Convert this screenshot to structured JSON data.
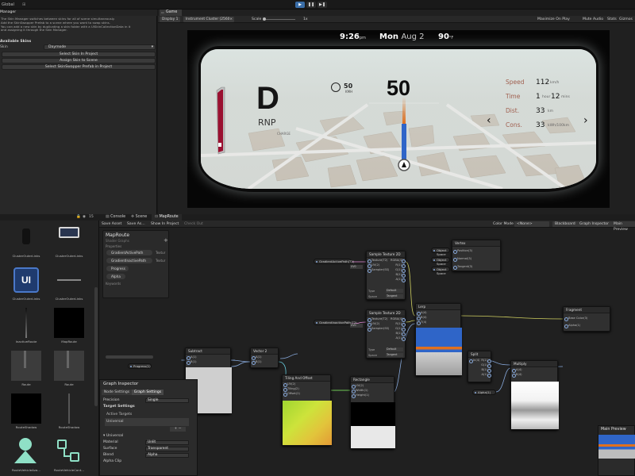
{
  "topbar": {
    "left_label": "Global",
    "play_buttons": [
      "▶",
      "❚❚",
      "▶❚"
    ]
  },
  "skin_manager": {
    "tab_label": "Manager",
    "description": [
      "The Skin Manager switches between skins for all of scene simultaneously.",
      "Add the SkinSwapper Prefab to a scene where you want to swap skins.",
      "You can add a new skin by duplicating a skin folder with a UISkinCollectionData in it",
      "and assigning it through the Skin Manager."
    ],
    "available_skins_label": "Available Skins",
    "skin_label": "Skin",
    "skin_value": "Daymode",
    "buttons": [
      "Select Skin In Project",
      "Assign Skin to Scene",
      "Select SkinSwapper Prefab in Project"
    ]
  },
  "game_view": {
    "tab_label": "Game",
    "display": "Display 1",
    "resolution": "Instrument Cluster (2560×",
    "scale_label": "Scale",
    "scale_value": "1x",
    "toolbar_right": [
      "Maximize On Play",
      "Mute Audio",
      "Stats",
      "Gizmos"
    ]
  },
  "cluster": {
    "time": "9:26",
    "time_suffix": "pm",
    "day": "Mon",
    "date": "Aug 2",
    "temp": "90",
    "temp_unit": "°F",
    "gear": "D",
    "gear_modes": "RNP",
    "charge_label": "CHARGE",
    "speed_limit": "50",
    "speed_limit_unit": "KMH",
    "speed": "50",
    "stats": [
      {
        "label": "Speed",
        "value": "112",
        "unit": "km/h"
      },
      {
        "label": "Time",
        "value": "1",
        "unit2": "hour",
        "value2": "12",
        "unit": "mins"
      },
      {
        "label": "Dist.",
        "value": "33",
        "unit": "km"
      },
      {
        "label": "Cons.",
        "value": "33",
        "unit": "kWh/100km"
      }
    ]
  },
  "project_panel": {
    "counter": "15",
    "items": [
      {
        "label": "ClusterOuterLinks",
        "kind": "dark-dot"
      },
      {
        "label": "ClusterOuterLinks",
        "kind": "box-icon"
      },
      {
        "label": "ClusterOuterLinks",
        "kind": "ui-icon"
      },
      {
        "label": "ClusterOuterLinks",
        "kind": "line"
      },
      {
        "label": "InactiveRoute",
        "kind": "gradient-line"
      },
      {
        "label": "MapRoute",
        "kind": "black"
      },
      {
        "label": "Route",
        "kind": "grey-route"
      },
      {
        "label": "Route",
        "kind": "grey-route"
      },
      {
        "label": "RouteShadow",
        "kind": "black"
      },
      {
        "label": "RouteShadow",
        "kind": "vline"
      },
      {
        "label": "RouteVehicleAva...",
        "kind": "avatar"
      },
      {
        "label": "RouteVehicleCont...",
        "kind": "control"
      }
    ]
  },
  "graph": {
    "tabs": [
      "Console",
      "Scene",
      "MapRoute"
    ],
    "toolbar_left": [
      "Save Asset",
      "Save As...",
      "Show In Project",
      "Check Out"
    ],
    "color_mode_label": "Color Mode",
    "color_mode_value": "<None>",
    "toolbar_right": [
      "Blackboard",
      "Graph Inspector",
      "Main Preview"
    ],
    "blackboard": {
      "title": "MapRoute",
      "subtitle": "Shader Graphs",
      "section": "Properties",
      "properties": [
        "GradientActivePath",
        "GradientInactivePath",
        "Progress",
        "Alpha"
      ],
      "property_types": [
        "Textur",
        "Textur",
        "",
        ""
      ],
      "keywords": "Keywords"
    },
    "nodes": {
      "sample_tex_1": "Sample Texture 2D",
      "sample_tex_2": "Sample Texture 2D",
      "lerp": "Lerp",
      "vertex": "Vertex",
      "fragment": "Fragment",
      "subtract": "Subtract",
      "vector2": "Vector 2",
      "tiling_offset": "Tiling And Offset",
      "rectangle": "Rectangle",
      "split": "Split",
      "multiply": "Multiply"
    },
    "vertex_ports": [
      "Position(3)",
      "Normal(3)",
      "Tangent(3)"
    ],
    "vertex_inputs": [
      "Object Space",
      "Object Space",
      "Object Space"
    ],
    "fragment_ports": [
      "Base Color(3)",
      "Alpha(1)"
    ],
    "prop_nodes": [
      "GradientActivePath(T2)",
      "GradientInactivePath(T2)",
      "Progress(1)",
      "Alpha(1)"
    ],
    "sample_ports_in": [
      "Texture(T2)",
      "UV(2)",
      "Sampler(SS)"
    ],
    "sample_ports_out": [
      "RGBA(4)",
      "R(1)",
      "G(1)",
      "B(1)",
      "A(1)"
    ],
    "sample_type_label": "Type",
    "sample_type_value": "Default",
    "sample_space_label": "Space",
    "sample_space_value": "Tangent",
    "lerp_ports": [
      "A(4)",
      "B(4)",
      "T(4)"
    ],
    "lerp_out": "Out(4)",
    "math_ports": [
      "A(1)",
      "B(1)"
    ],
    "math_out": "Out(1)",
    "tiling_ports": [
      "UV(2)",
      "Tiling(2)",
      "Offset(2)"
    ],
    "tiling_out": "Out(2)",
    "rect_ports": [
      "UV(2)",
      "Width(1)",
      "Height(1)"
    ],
    "rect_out": "Out(1)",
    "split_in": "In(4)",
    "split_out": [
      "R(1)",
      "G(1)",
      "B(1)",
      "A(1)"
    ],
    "multiply_ports": [
      "A(4)",
      "B(4)"
    ],
    "multiply_out": "Out(4)",
    "uv_label": "UV0",
    "graph_inspector": {
      "title": "Graph Inspector",
      "tabs": [
        "Node Settings",
        "Graph Settings"
      ],
      "precision_label": "Precision",
      "precision_value": "Single",
      "target_settings": "Target Settings",
      "active_targets": "Active Targets",
      "target_item": "Universal",
      "add_remove": "+ −",
      "universal_section": "Universal",
      "material_label": "Material",
      "material_value": "Unlit",
      "surface_label": "Surface",
      "surface_value": "Transparent",
      "blend_label": "Blend",
      "blend_value": "Alpha",
      "alpha_clip_label": "Alpha Clip"
    },
    "main_preview": "Main Preview"
  },
  "colors": {
    "accent_blue": "#3a6ea8",
    "route_blue": "#2f65c8",
    "route_orange": "#e0701e",
    "gear_red": "#9a1030"
  }
}
